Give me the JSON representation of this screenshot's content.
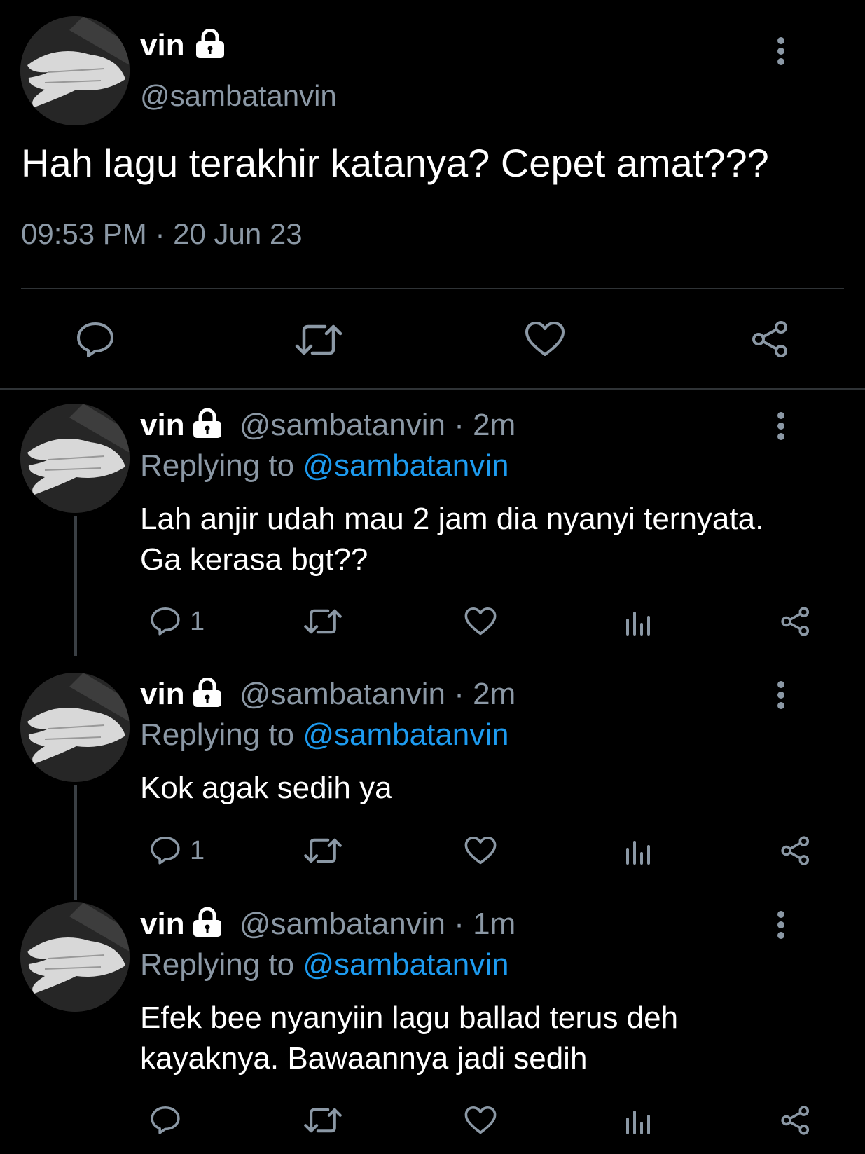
{
  "main_tweet": {
    "name": "vin",
    "handle": "@sambatanvin",
    "text": "Hah lagu terakhir katanya? Cepet amat???",
    "timestamp": "09:53 PM · 20 Jun 23"
  },
  "replies": [
    {
      "name": "vin",
      "handle": "@sambatanvin",
      "time_sep": "·",
      "time": "2m",
      "replying_prefix": "Replying to",
      "replying_handle": "@sambatanvin",
      "text_lines": [
        "Lah anjir udah mau 2 jam dia nyanyi ternyata.",
        "Ga kerasa bgt??"
      ],
      "reply_count": "1"
    },
    {
      "name": "vin",
      "handle": "@sambatanvin",
      "time_sep": "·",
      "time": "2m",
      "replying_prefix": "Replying to",
      "replying_handle": "@sambatanvin",
      "text_lines": [
        "Kok agak sedih ya"
      ],
      "reply_count": "1"
    },
    {
      "name": "vin",
      "handle": "@sambatanvin",
      "time_sep": "·",
      "time": "1m",
      "replying_prefix": "Replying to",
      "replying_handle": "@sambatanvin",
      "text_lines": [
        "Efek bee nyanyiin lagu ballad terus deh",
        "kayaknya. Bawaannya jadi sedih"
      ],
      "reply_count": ""
    }
  ],
  "colors": {
    "background": "#000000",
    "text": "#ffffff",
    "secondary": "#8b98a5",
    "link": "#1d9bf0",
    "divider": "#2f3336"
  },
  "icons": [
    "lock-icon",
    "more-icon",
    "reply-icon",
    "retweet-icon",
    "like-icon",
    "views-icon",
    "share-icon"
  ]
}
